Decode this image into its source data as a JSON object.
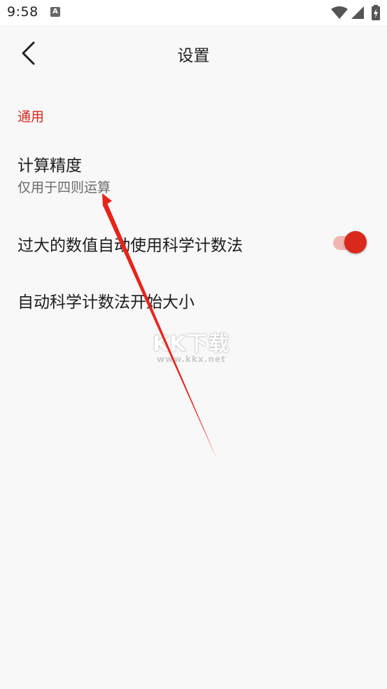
{
  "status_bar": {
    "time": "9:58",
    "notification_icon": "A"
  },
  "app_bar": {
    "back_icon": "chevron-left-icon",
    "title": "设置"
  },
  "sections": [
    {
      "header": "通用",
      "items": [
        {
          "title": "计算精度",
          "subtitle": "仅用于四则运算"
        },
        {
          "title": "过大的数值自动使用科学计数法",
          "toggle_on": true
        },
        {
          "title": "自动科学计数法开始大小"
        }
      ]
    }
  ],
  "watermark": {
    "logo": "KK下载",
    "url": "www.kkx.net"
  },
  "colors": {
    "accent": "#d9291d",
    "toggle_track": "#f2b6b1",
    "background": "#f8f8f8",
    "annotation_arrow": "#e8231a"
  }
}
